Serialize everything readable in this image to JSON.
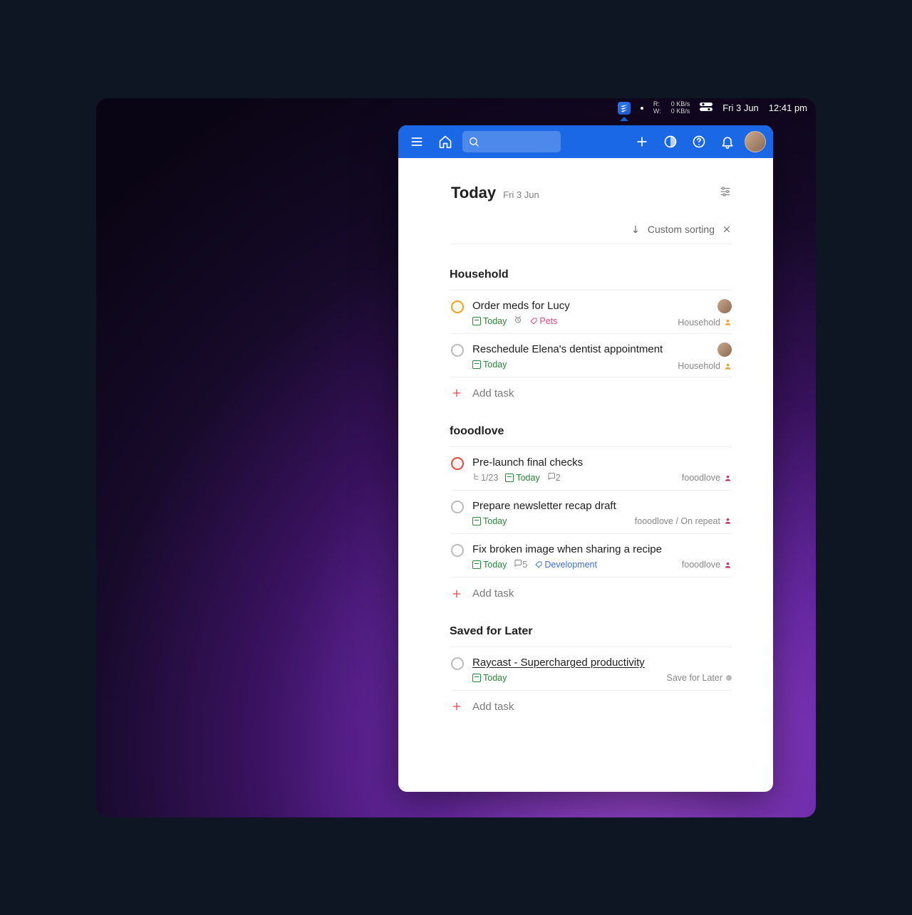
{
  "menubar": {
    "rw_label_r": "R:",
    "rw_label_w": "W:",
    "net_up": "0 KB/s",
    "net_down": "0 KB/s",
    "date": "Fri 3 Jun",
    "time": "12:41 pm"
  },
  "view": {
    "title": "Today",
    "date": "Fri 3 Jun",
    "sort_label": "Custom sorting"
  },
  "sections": [
    {
      "name": "Household",
      "tasks": [
        {
          "title": "Order meds for Lucy",
          "priority": "orange",
          "due": "Today",
          "has_reminder": true,
          "tag": "Pets",
          "tag_style": "pets",
          "project": "Household",
          "project_color": "person-orange",
          "assigned": true
        },
        {
          "title": "Reschedule Elena's dentist appointment",
          "priority": "none",
          "due": "Today",
          "project": "Household",
          "project_color": "person-orange",
          "assigned": true
        }
      ],
      "add": "Add task"
    },
    {
      "name": "fooodlove",
      "tasks": [
        {
          "title": "Pre-launch final checks",
          "priority": "red",
          "subtasks": "1/23",
          "due": "Today",
          "comments": "2",
          "project": "fooodlove",
          "project_color": "person-pink"
        },
        {
          "title": "Prepare newsletter recap draft",
          "priority": "none",
          "due": "Today",
          "project": "fooodlove / On repeat",
          "project_color": "person-pink"
        },
        {
          "title": "Fix broken image when sharing a recipe",
          "priority": "none",
          "due": "Today",
          "comments": "5",
          "tag": "Development",
          "tag_style": "dev",
          "project": "fooodlove",
          "project_color": "person-pink"
        }
      ],
      "add": "Add task"
    },
    {
      "name": "Saved for Later",
      "tasks": [
        {
          "title": "Raycast - Supercharged productivity",
          "title_underline": true,
          "priority": "none",
          "due": "Today",
          "project": "Save for Later",
          "project_color": "grey"
        }
      ],
      "add": "Add task"
    }
  ]
}
